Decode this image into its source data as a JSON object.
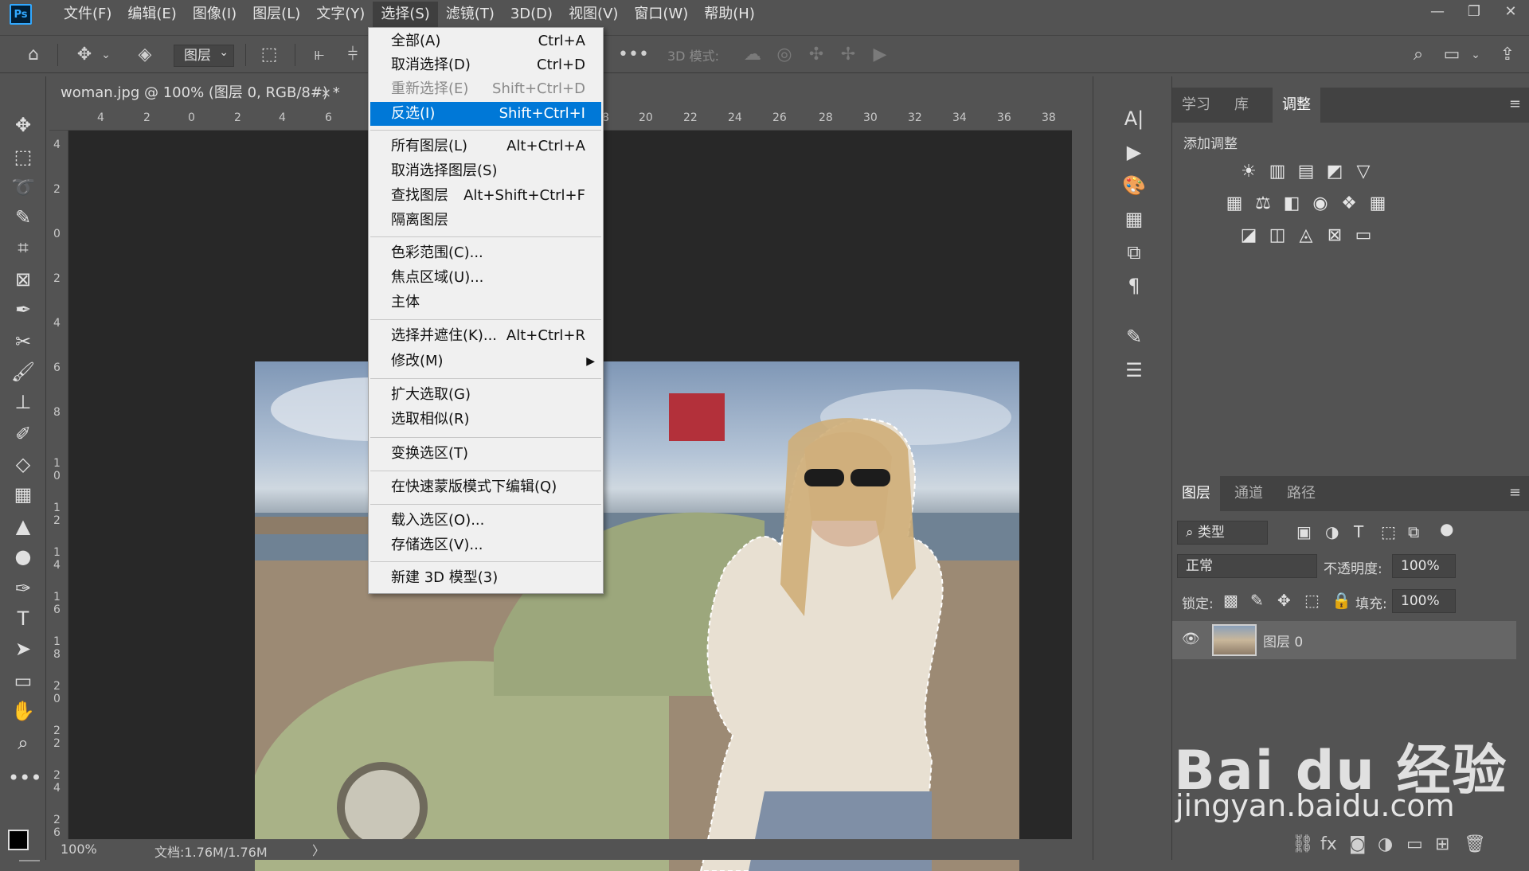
{
  "app": {
    "logo": "Ps"
  },
  "menubar": {
    "items": [
      "文件(F)",
      "编辑(E)",
      "图像(I)",
      "图层(L)",
      "文字(Y)",
      "选择(S)",
      "滤镜(T)",
      "3D(D)",
      "视图(V)",
      "窗口(W)",
      "帮助(H)"
    ],
    "active": "选择(S)",
    "window_controls": [
      "—",
      "❐",
      "✕"
    ]
  },
  "options_bar": {
    "layer_select": "图层",
    "mode_3d_label": "3D 模式:"
  },
  "document": {
    "tab_title": "woman.jpg @ 100% (图层 0, RGB/8#) *",
    "close": "×",
    "zoom": "100%",
    "doc_info": "文档:1.76M/1.76M",
    "ruler_top": [
      "4",
      "2",
      "0",
      "2",
      "4",
      "6",
      "8",
      "20",
      "22",
      "24",
      "26",
      "28",
      "30",
      "32",
      "34",
      "36",
      "38"
    ],
    "ruler_left": [
      "4",
      "2",
      "0",
      "2",
      "4",
      "6",
      "8",
      "1 0",
      "1 2",
      "1 4",
      "1 6",
      "1 8",
      "2 0",
      "2 2",
      "2 4",
      "2 6"
    ]
  },
  "select_menu": {
    "items": [
      {
        "label": "全部(A)",
        "shortcut": "Ctrl+A"
      },
      {
        "label": "取消选择(D)",
        "shortcut": "Ctrl+D"
      },
      {
        "label": "重新选择(E)",
        "shortcut": "Shift+Ctrl+D",
        "disabled": true
      },
      {
        "label": "反选(I)",
        "shortcut": "Shift+Ctrl+I",
        "highlighted": true
      },
      {
        "label": "所有图层(L)",
        "shortcut": "Alt+Ctrl+A"
      },
      {
        "label": "取消选择图层(S)",
        "shortcut": ""
      },
      {
        "label": "查找图层",
        "shortcut": "Alt+Shift+Ctrl+F"
      },
      {
        "label": "隔离图层",
        "shortcut": ""
      },
      {
        "label": "色彩范围(C)...",
        "shortcut": ""
      },
      {
        "label": "焦点区域(U)...",
        "shortcut": ""
      },
      {
        "label": "主体",
        "shortcut": ""
      },
      {
        "label": "选择并遮住(K)...",
        "shortcut": "Alt+Ctrl+R"
      },
      {
        "label": "修改(M)",
        "shortcut": "▶"
      },
      {
        "label": "扩大选取(G)",
        "shortcut": ""
      },
      {
        "label": "选取相似(R)",
        "shortcut": ""
      },
      {
        "label": "变换选区(T)",
        "shortcut": ""
      },
      {
        "label": "在快速蒙版模式下编辑(Q)",
        "shortcut": ""
      },
      {
        "label": "载入选区(O)...",
        "shortcut": ""
      },
      {
        "label": "存储选区(V)...",
        "shortcut": ""
      },
      {
        "label": "新建 3D 模型(3)",
        "shortcut": ""
      }
    ]
  },
  "adjust_panel": {
    "tabs": [
      "学习",
      "库",
      "调整"
    ],
    "active_tab": "调整",
    "title": "添加调整"
  },
  "layers_panel": {
    "tabs": [
      "图层",
      "通道",
      "路径"
    ],
    "active_tab": "图层",
    "filter_kind": "类型",
    "blend_mode": "正常",
    "opacity_label": "不透明度:",
    "opacity": "100%",
    "lock_label": "锁定:",
    "fill_label": "填充:",
    "fill": "100%",
    "layer_name": "图层 0"
  },
  "watermark": {
    "logo": "Bai du 经验",
    "url": "jingyan.baidu.com"
  }
}
